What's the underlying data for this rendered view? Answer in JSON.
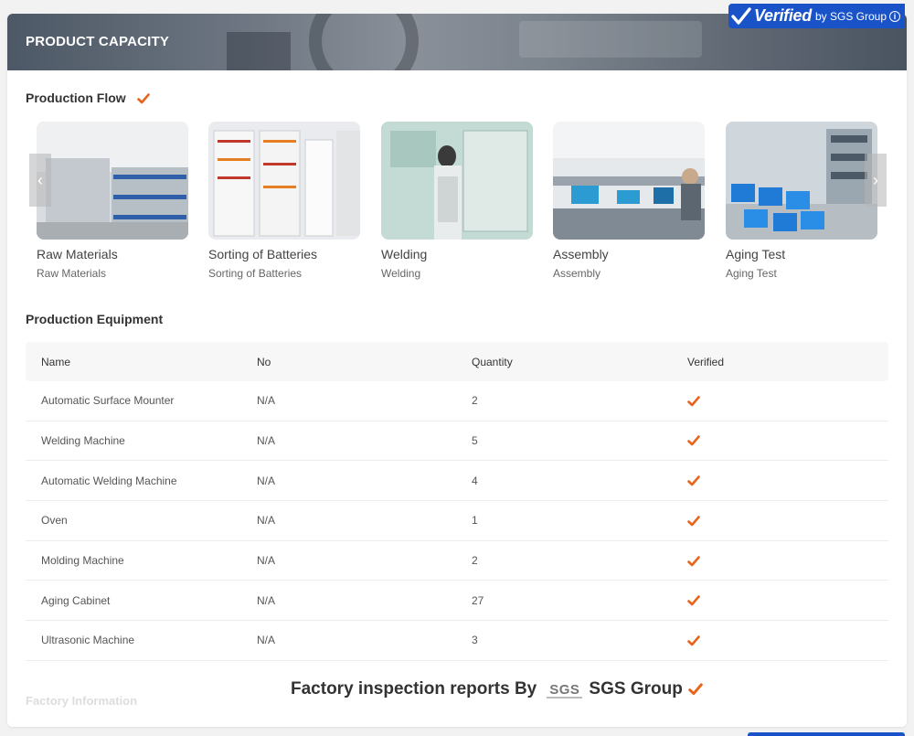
{
  "header": {
    "title": "PRODUCT CAPACITY",
    "verified": {
      "word": "Verified",
      "by": "by SGS Group",
      "info": "i"
    }
  },
  "production_flow": {
    "title": "Production Flow",
    "items": [
      {
        "label": "Raw Materials",
        "sub": "Raw Materials"
      },
      {
        "label": "Sorting of Batteries",
        "sub": "Sorting of Batteries"
      },
      {
        "label": "Welding",
        "sub": "Welding"
      },
      {
        "label": "Assembly",
        "sub": "Assembly"
      },
      {
        "label": "Aging Test",
        "sub": "Aging Test"
      }
    ]
  },
  "production_equipment": {
    "title": "Production Equipment",
    "headers": [
      "Name",
      "No",
      "Quantity",
      "Verified"
    ],
    "rows": [
      {
        "name": "Automatic Surface Mounter",
        "no": "N/A",
        "quantity": "2"
      },
      {
        "name": "Welding Machine",
        "no": "N/A",
        "quantity": "5"
      },
      {
        "name": "Automatic Welding Machine",
        "no": "N/A",
        "quantity": "4"
      },
      {
        "name": "Oven",
        "no": "N/A",
        "quantity": "1"
      },
      {
        "name": "Molding Machine",
        "no": "N/A",
        "quantity": "2"
      },
      {
        "name": "Aging Cabinet",
        "no": "N/A",
        "quantity": "27"
      },
      {
        "name": "Ultrasonic Machine",
        "no": "N/A",
        "quantity": "3"
      }
    ]
  },
  "footer": {
    "faded_heading": "Factory Information",
    "report_text": "Factory inspection reports By",
    "sgs_logo": "SGS",
    "sgs_group": "SGS Group"
  },
  "colors": {
    "accent": "#e8641b",
    "verified_blue": "#1a53c7"
  },
  "icons": {
    "check": "check-icon",
    "prev": "chevron-left-icon",
    "next": "chevron-right-icon"
  }
}
